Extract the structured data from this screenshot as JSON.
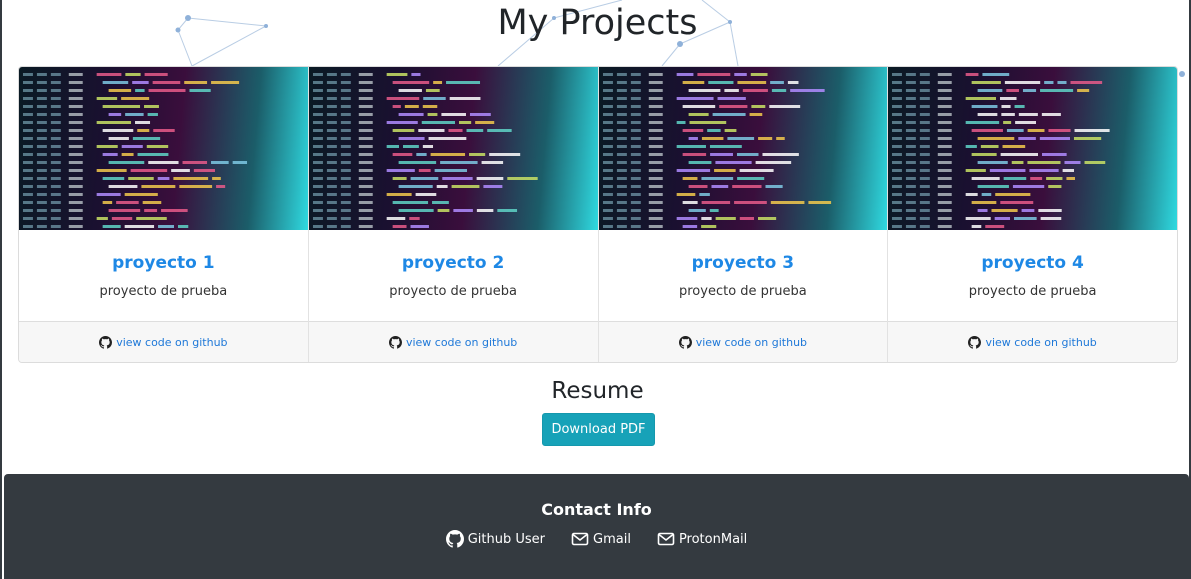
{
  "page": {
    "title": "My Projects"
  },
  "projects": [
    {
      "title": "proyecto 1",
      "description": "proyecto de prueba",
      "link_label": "view code on github"
    },
    {
      "title": "proyecto 2",
      "description": "proyecto de prueba",
      "link_label": "view code on github"
    },
    {
      "title": "proyecto 3",
      "description": "proyecto de prueba",
      "link_label": "view code on github"
    },
    {
      "title": "proyecto 4",
      "description": "proyecto de prueba",
      "link_label": "view code on github"
    }
  ],
  "resume": {
    "title": "Resume",
    "button_label": "Download PDF"
  },
  "footer": {
    "title": "Contact Info",
    "links": [
      {
        "label": "Github User",
        "icon": "github-icon"
      },
      {
        "label": "Gmail",
        "icon": "envelope-icon"
      },
      {
        "label": "ProtonMail",
        "icon": "envelope-icon"
      }
    ]
  },
  "colors": {
    "link": "#1e88e5",
    "button": "#17a2b8",
    "footer_bg": "#343a40"
  }
}
